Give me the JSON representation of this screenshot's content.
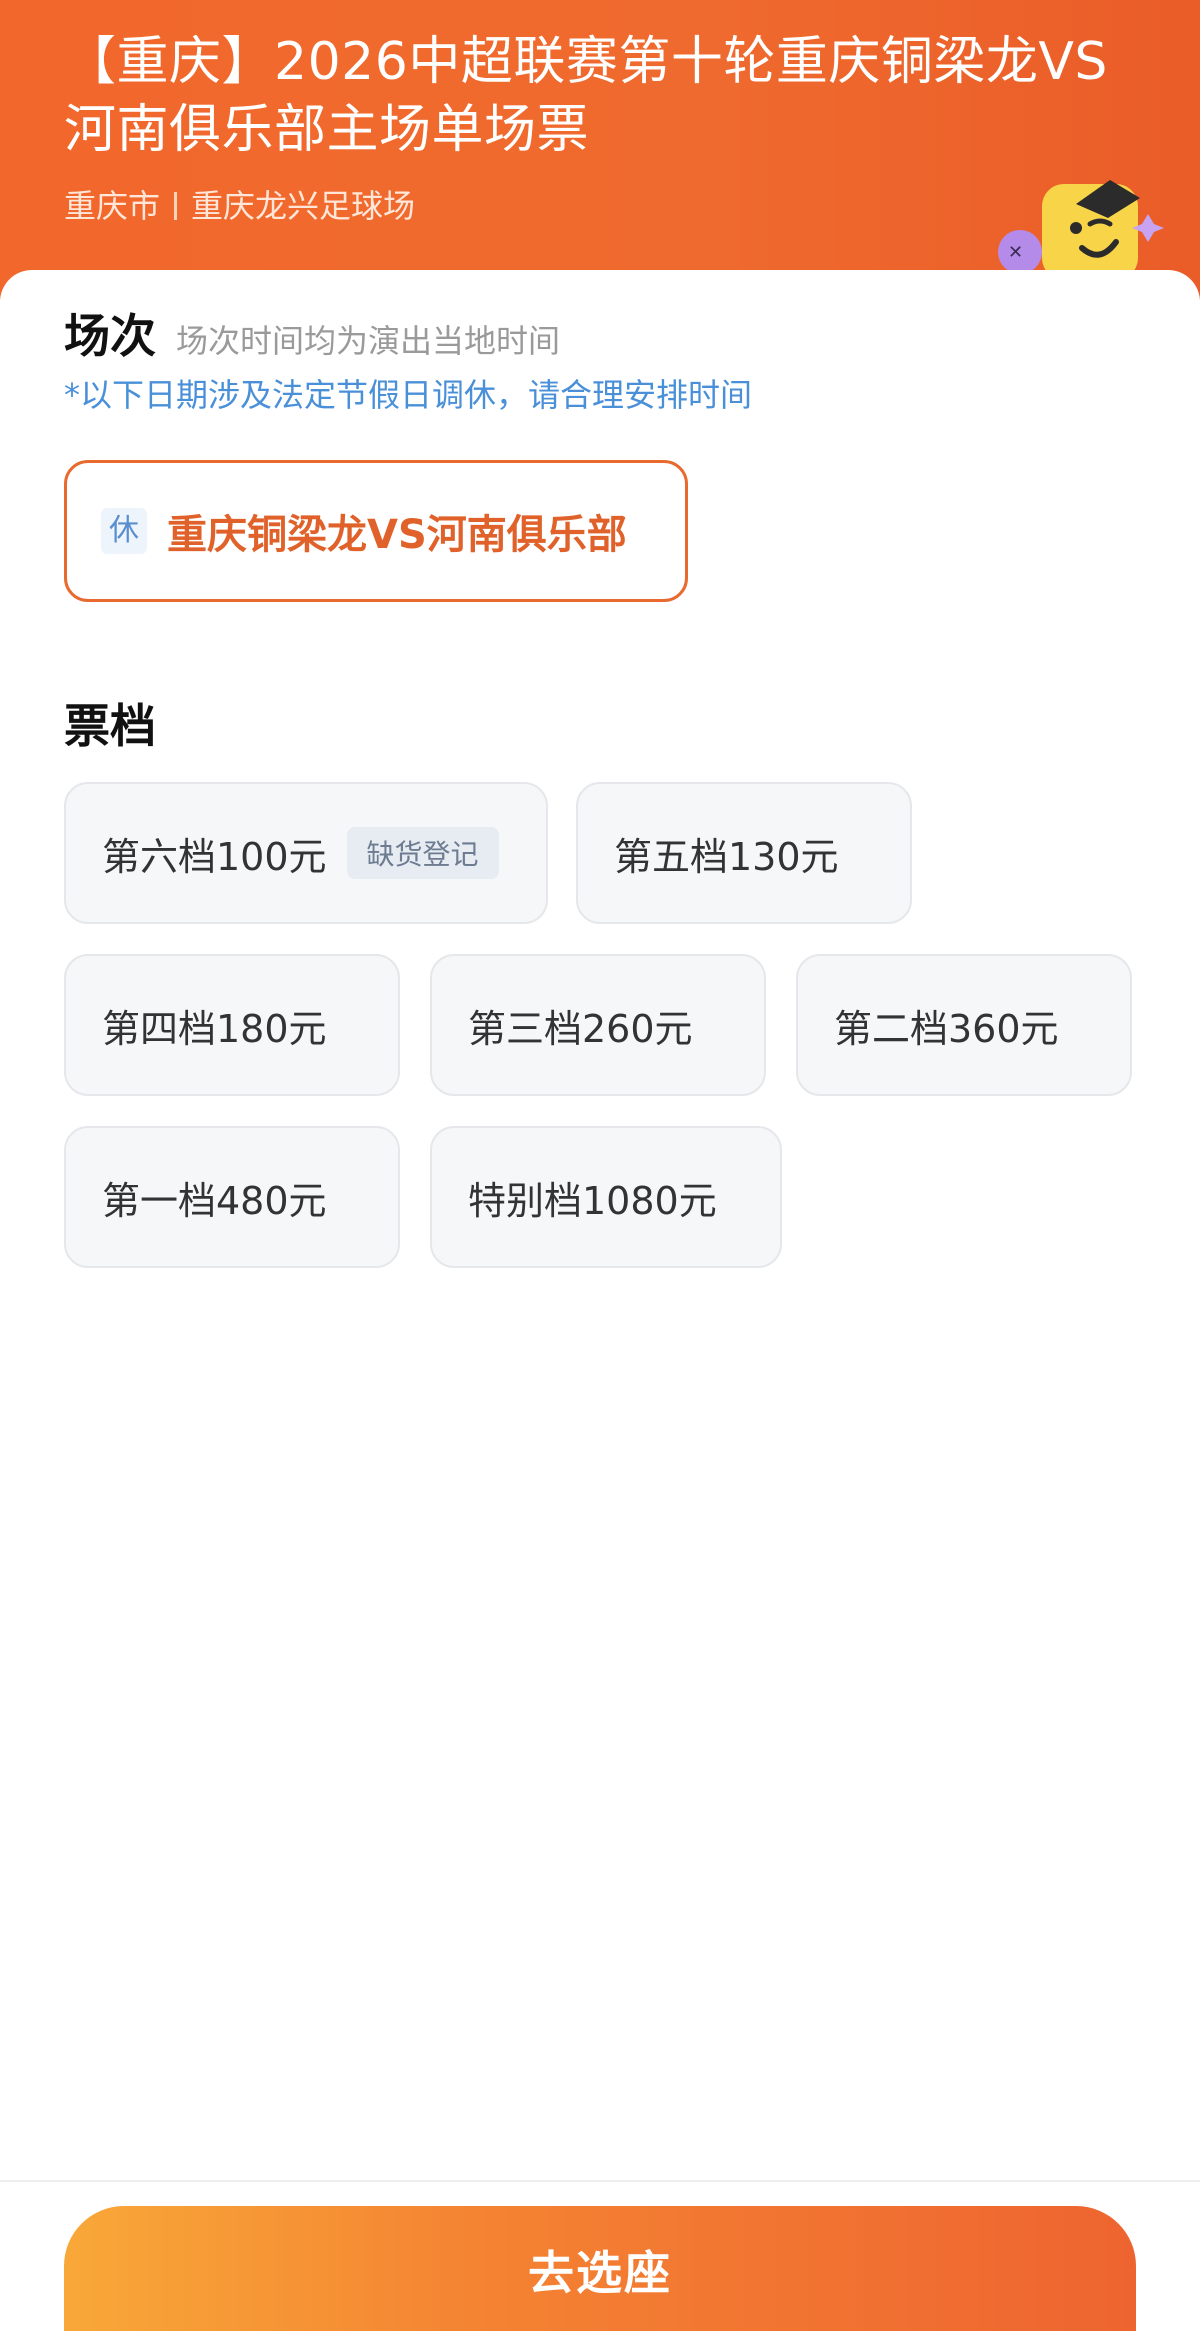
{
  "header": {
    "title": "【重庆】2026中超联赛第十轮重庆铜梁龙VS河南俱乐部主场单场票",
    "city": "重庆市",
    "venue": "重庆龙兴足球场"
  },
  "session": {
    "title": "场次",
    "subtitle": "场次时间均为演出当地时间",
    "holiday_note": "*以下日期涉及法定节假日调休，请合理安排时间",
    "rest_tag": "休",
    "match_name": "重庆铜梁龙VS河南俱乐部"
  },
  "tiers": {
    "title": "票档",
    "items": [
      {
        "label": "第六档100元",
        "badge": "缺货登记"
      },
      {
        "label": "第五档130元"
      },
      {
        "label": "第四档180元"
      },
      {
        "label": "第三档260元"
      },
      {
        "label": "第二档360元"
      },
      {
        "label": "第一档480元"
      },
      {
        "label": "特别档1080元"
      }
    ]
  },
  "footer": {
    "cta_label": "去选座"
  },
  "colors": {
    "brand_orange": "#f2682c",
    "selected_border": "#e96a2f",
    "note_blue": "#4a90d9"
  }
}
